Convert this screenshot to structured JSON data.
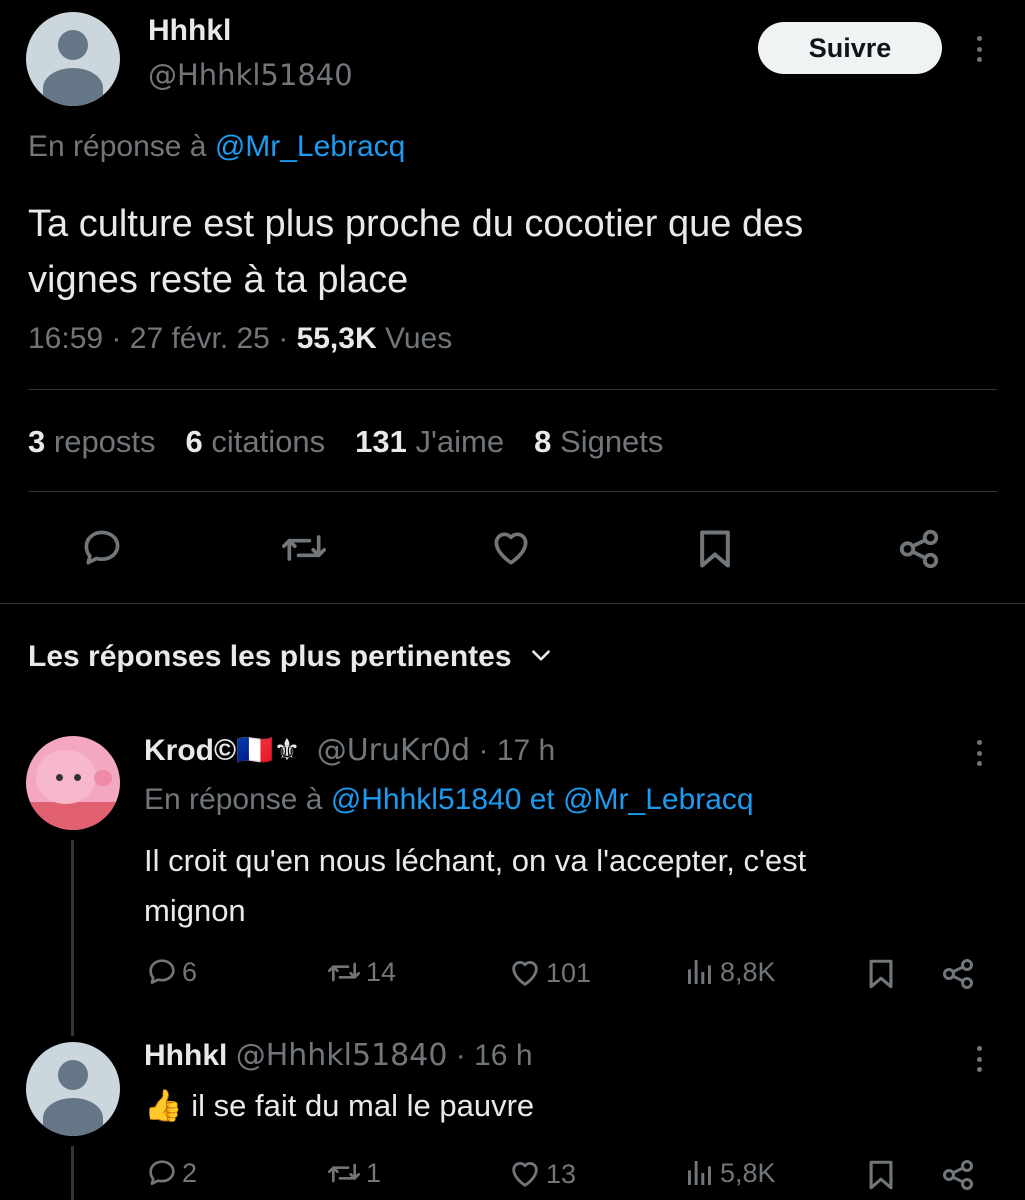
{
  "main_tweet": {
    "author_name": "Hhhkl",
    "author_handle": "@Hhhkl51840",
    "follow_label": "Suivre",
    "reply_prefix": "En réponse à",
    "reply_to": "@Mr_Lebracq",
    "text_line1": "Ta culture est plus proche du cocotier que des",
    "text_line2": "vignes reste à ta place",
    "time": "16:59",
    "sep1": "·",
    "date": "27 févr. 25",
    "sep2": "·",
    "views_count": "55,3K",
    "views_label": "Vues",
    "stats": {
      "reposts_count": "3",
      "reposts_label": "reposts",
      "quotes_count": "6",
      "quotes_label": "citations",
      "likes_count": "131",
      "likes_label": "J'aime",
      "bookmarks_count": "8",
      "bookmarks_label": "Signets"
    }
  },
  "replies_header": "Les réponses les plus pertinentes",
  "replies": [
    {
      "name": "Krod©",
      "flags": "🇫🇷⚜",
      "handle": "@UruKr0d",
      "sep": "·",
      "time": "17 h",
      "reply_prefix": "En réponse à",
      "reply_to": "@Hhhkl51840 et @Mr_Lebracq",
      "text_line1": "Il croit qu'en nous léchant, on va l'accepter, c'est",
      "text_line2": "mignon",
      "replies": "6",
      "reposts": "14",
      "likes": "101",
      "views": "8,8K"
    },
    {
      "name": "Hhhkl",
      "handle": "@Hhhkl51840",
      "sep": "·",
      "time": "16 h",
      "emoji": "👍",
      "text": "il se fait du mal le pauvre",
      "replies": "2",
      "reposts": "1",
      "likes": "13",
      "views": "5,8K"
    }
  ],
  "colors": {
    "background": "#000000",
    "text": "#e7e9ea",
    "muted": "#71767b",
    "link": "#1d9bf0",
    "divider": "#2f3336"
  }
}
